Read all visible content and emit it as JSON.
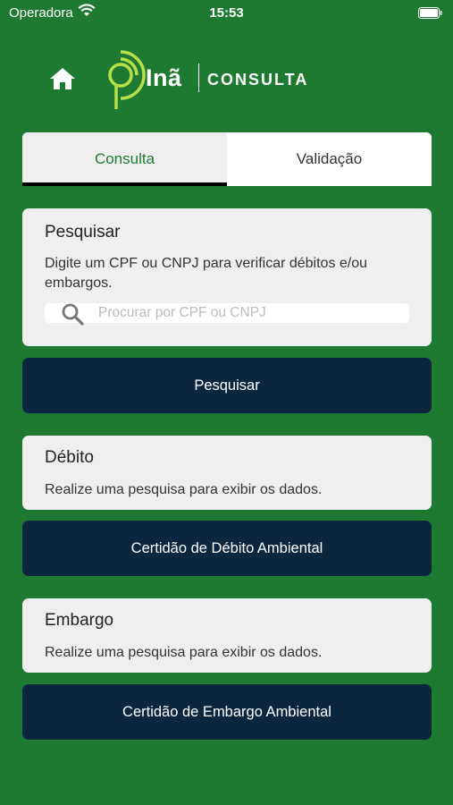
{
  "status_bar": {
    "carrier": "Operadora",
    "time": "15:53"
  },
  "header": {
    "logo_word": "Inã",
    "logo_sub": "CONSULTA"
  },
  "tabs": [
    {
      "label": "Consulta",
      "active": true
    },
    {
      "label": "Validação",
      "active": false
    }
  ],
  "search_card": {
    "title": "Pesquisar",
    "description": "Digite um CPF ou CNPJ para verificar débitos e/ou embargos.",
    "placeholder": "Procurar por CPF ou CNPJ",
    "value": ""
  },
  "search_button": {
    "label": "Pesquisar"
  },
  "debit_card": {
    "title": "Débito",
    "text": "Realize uma pesquisa para exibir os dados."
  },
  "debit_button": {
    "label": "Certidão de Débito Ambiental"
  },
  "embargo_card": {
    "title": "Embargo",
    "text": "Realize uma pesquisa para exibir os dados."
  },
  "embargo_button": {
    "label": "Certidão de Embargo Ambiental"
  },
  "colors": {
    "background": "#1f7a31",
    "button": "#0b2740",
    "card": "#efefef",
    "logo_accent": "#b6e04a"
  }
}
